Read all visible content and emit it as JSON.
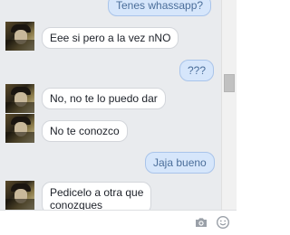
{
  "messages": [
    {
      "id": "m1",
      "direction": "outgoing",
      "text": "Tenes whassapp?"
    },
    {
      "id": "m2",
      "direction": "incoming",
      "text": "Eee si pero a la vez nNO"
    },
    {
      "id": "m3",
      "direction": "outgoing",
      "text": "???"
    },
    {
      "id": "m4",
      "direction": "incoming",
      "text": "No, no te lo puedo dar"
    },
    {
      "id": "m5",
      "direction": "incoming",
      "text": "No te conozco"
    },
    {
      "id": "m6",
      "direction": "outgoing",
      "text": "Jaja bueno"
    },
    {
      "id": "m7",
      "direction": "incoming",
      "line1": "Pedicelo a otra que",
      "line2": "conozques"
    }
  ],
  "composer": {
    "placeholder": ""
  },
  "icons": {
    "photo": "camera-icon",
    "emoji": "smiley-icon"
  },
  "colors": {
    "chat_background": "#e9ebee",
    "incoming_bubble": "#ffffff",
    "outgoing_bubble": "#d6e6fb",
    "outgoing_text": "#4b6e9a"
  }
}
